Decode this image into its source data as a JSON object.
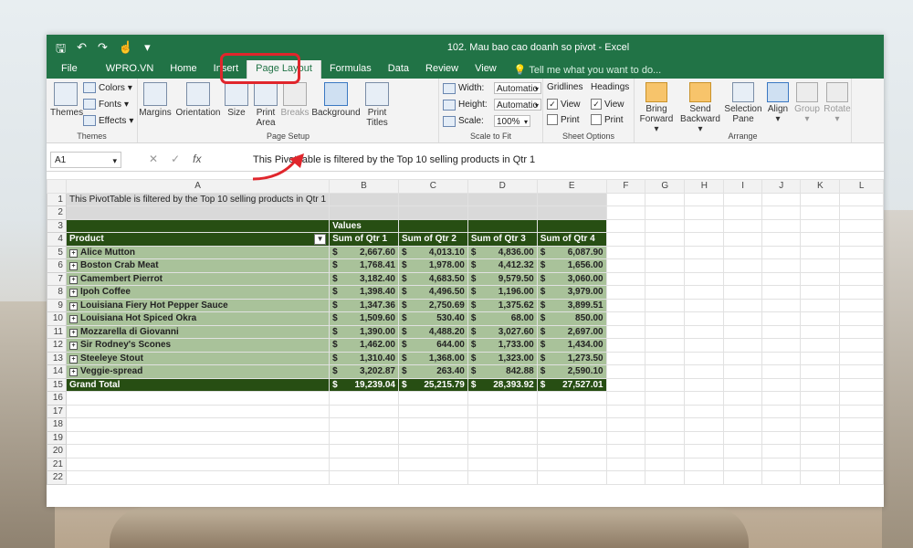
{
  "window_title": "102. Mau bao cao doanh so pivot - Excel",
  "tabs": [
    "File",
    "WPRO.VN",
    "Home",
    "Insert",
    "Page Layout",
    "Formulas",
    "Data",
    "Review",
    "View"
  ],
  "active_tab": "Page Layout",
  "tell_me": "Tell me what you want to do...",
  "ribbon": {
    "themes": {
      "themes_label": "Themes",
      "colors": "Colors",
      "fonts": "Fonts",
      "effects": "Effects",
      "group": "Themes"
    },
    "page_setup": {
      "margins": "Margins",
      "orientation": "Orientation",
      "size": "Size",
      "print_area_1": "Print",
      "print_area_2": "Area",
      "breaks": "Breaks",
      "background": "Background",
      "print_titles_1": "Print",
      "print_titles_2": "Titles",
      "group": "Page Setup"
    },
    "scale": {
      "width_label": "Width:",
      "width_value": "Automatic",
      "height_label": "Height:",
      "height_value": "Automatic",
      "scale_label": "Scale:",
      "scale_value": "100%",
      "group": "Scale to Fit"
    },
    "sheet_options": {
      "gridlines": "Gridlines",
      "headings": "Headings",
      "view": "View",
      "print": "Print",
      "group": "Sheet Options"
    },
    "arrange": {
      "bring_1": "Bring",
      "bring_2": "Forward",
      "send_1": "Send",
      "send_2": "Backward",
      "selection_1": "Selection",
      "selection_2": "Pane",
      "align": "Align",
      "group_btn": "Group",
      "rotate": "Rotate",
      "group": "Arrange"
    }
  },
  "name_box": "A1",
  "formula": "This PivotTable is filtered by the Top 10 selling products in Qtr 1",
  "columns": [
    "A",
    "B",
    "C",
    "D",
    "E",
    "F",
    "G",
    "H",
    "I",
    "J",
    "K",
    "L"
  ],
  "sheet": {
    "note": "This PivotTable is filtered by the Top 10 selling products in Qtr 1",
    "values_label": "Values",
    "product_label": "Product",
    "headers": [
      "Sum of Qtr 1",
      "Sum of Qtr 2",
      "Sum of Qtr 3",
      "Sum of Qtr 4"
    ],
    "currency": "$",
    "rows": [
      {
        "name": "Alice Mutton",
        "v": [
          "2,667.60",
          "4,013.10",
          "4,836.00",
          "6,087.90"
        ]
      },
      {
        "name": "Boston Crab Meat",
        "v": [
          "1,768.41",
          "1,978.00",
          "4,412.32",
          "1,656.00"
        ]
      },
      {
        "name": "Camembert Pierrot",
        "v": [
          "3,182.40",
          "4,683.50",
          "9,579.50",
          "3,060.00"
        ]
      },
      {
        "name": "Ipoh Coffee",
        "v": [
          "1,398.40",
          "4,496.50",
          "1,196.00",
          "3,979.00"
        ]
      },
      {
        "name": "Louisiana Fiery Hot Pepper Sauce",
        "v": [
          "1,347.36",
          "2,750.69",
          "1,375.62",
          "3,899.51"
        ]
      },
      {
        "name": "Louisiana Hot Spiced Okra",
        "v": [
          "1,509.60",
          "530.40",
          "68.00",
          "850.00"
        ]
      },
      {
        "name": "Mozzarella di Giovanni",
        "v": [
          "1,390.00",
          "4,488.20",
          "3,027.60",
          "2,697.00"
        ]
      },
      {
        "name": "Sir Rodney's Scones",
        "v": [
          "1,462.00",
          "644.00",
          "1,733.00",
          "1,434.00"
        ]
      },
      {
        "name": "Steeleye Stout",
        "v": [
          "1,310.40",
          "1,368.00",
          "1,323.00",
          "1,273.50"
        ]
      },
      {
        "name": "Veggie-spread",
        "v": [
          "3,202.87",
          "263.40",
          "842.88",
          "2,590.10"
        ]
      }
    ],
    "grand_total_label": "Grand Total",
    "grand_total": [
      "19,239.04",
      "25,215.79",
      "28,393.92",
      "27,527.01"
    ]
  }
}
